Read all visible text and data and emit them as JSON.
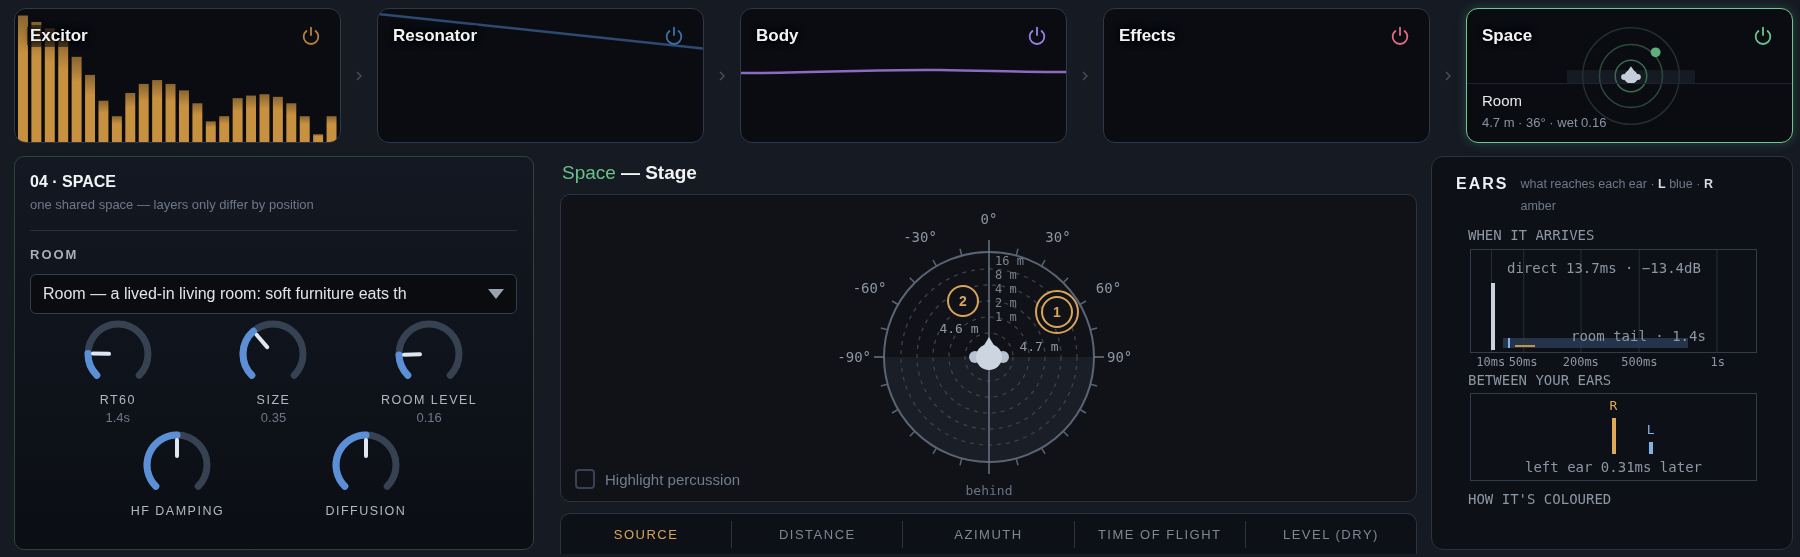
{
  "modules": [
    {
      "name": "Excitor",
      "kind": "bars",
      "color": "#b87d3c",
      "selected": false
    },
    {
      "name": "Resonator",
      "kind": "falling-line",
      "color": "#3e6fa3",
      "selected": false
    },
    {
      "name": "Body",
      "kind": "flat-line",
      "color": "#9b7fe6",
      "selected": false
    },
    {
      "name": "Effects",
      "kind": "empty",
      "color": "#e06a82",
      "selected": false
    },
    {
      "name": "Space",
      "kind": "room",
      "color": "#67c48a",
      "selected": true,
      "subtitle": "Room",
      "detail": "4.7 m · 36° · wet 0.16"
    }
  ],
  "space_panel": {
    "title": "04 · SPACE",
    "subtitle": "one shared space — layers only differ by position",
    "room_label": "ROOM",
    "room_select": {
      "value": "Room — a lived-in living room: soft furniture eats th"
    },
    "knobs": [
      {
        "label": "RT60",
        "value": "1.4s"
      },
      {
        "label": "SIZE",
        "value": "0.35"
      },
      {
        "label": "ROOM LEVEL",
        "value": "0.16"
      },
      {
        "label": "HF DAMPING"
      },
      {
        "label": "DIFFUSION"
      }
    ]
  },
  "stage": {
    "title_section": "Space",
    "title": "— Stage",
    "angle_labels": [
      "0°",
      "-30°",
      "30°",
      "-60°",
      "60°",
      "-90°",
      "90°"
    ],
    "rear_label": "behind",
    "ring_labels": [
      "16 m",
      "8 m",
      "4 m",
      "2 m",
      "1 m"
    ],
    "sources": [
      {
        "number": "1",
        "distance": "4.7 m",
        "selected": true
      },
      {
        "number": "2",
        "distance": "4.6 m",
        "selected": false
      }
    ],
    "highlight_percussion": {
      "label": "Highlight percussion",
      "checked": false
    }
  },
  "tabs": [
    {
      "label": "SOURCE",
      "selected": true
    },
    {
      "label": "DISTANCE",
      "selected": false
    },
    {
      "label": "AZIMUTH",
      "selected": false
    },
    {
      "label": "TIME OF FLIGHT",
      "selected": false
    },
    {
      "label": "LEVEL (DRY)",
      "selected": false
    }
  ],
  "ears": {
    "title": "EARS",
    "subtitle": "what reaches each ear · **L** blue · **R** amber",
    "arrival": {
      "heading": "WHEN IT ARRIVES",
      "direct_label": "direct 13.7ms · −13.4dB",
      "tail_label": "room tail · 1.4s",
      "ticks": [
        "10ms",
        "50ms",
        "200ms",
        "500ms",
        "1s"
      ]
    },
    "between": {
      "heading": "BETWEEN YOUR EARS",
      "ears": [
        {
          "label": "R",
          "color": "#e0a85a"
        },
        {
          "label": "L",
          "color": "#7fb3e8"
        }
      ],
      "caption": "left ear 0.31ms later"
    },
    "colour_heading": "HOW IT'S COLOURED"
  }
}
